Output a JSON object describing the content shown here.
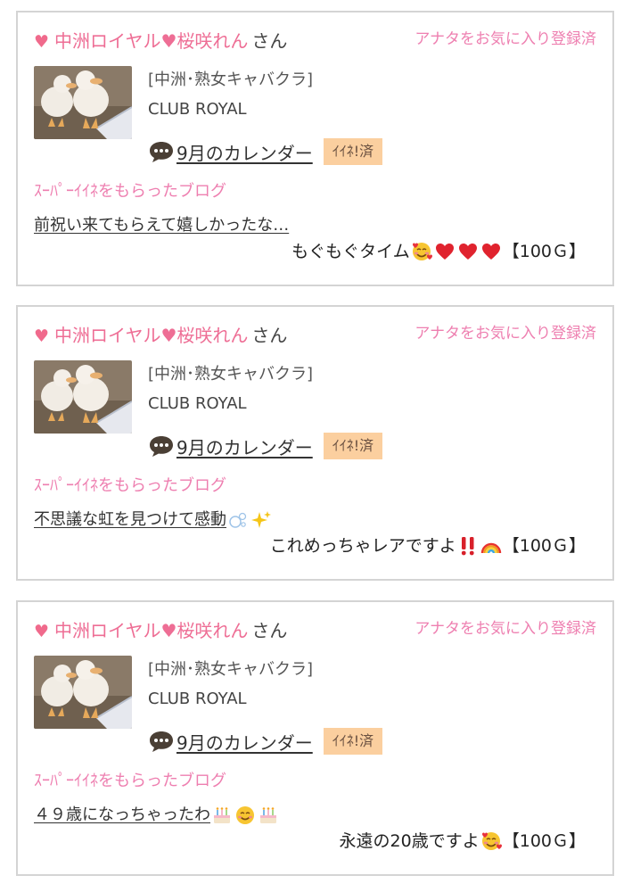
{
  "posts": [
    {
      "shop_name": "中洲ロイヤル♥桜咲れん",
      "honorific": "さん",
      "favorite_status": "アナタをお気に入り登録済",
      "genre": "[中洲･熟女キャバクラ]",
      "store": "CLUB ROYAL",
      "calendar_link": "9月のカレンダー",
      "iine_badge": "ｲｲﾈ!済",
      "super_label": "ｽｰﾊﾟｰｲｲﾈをもらったブログ",
      "blog_title": "前祝い来てもらえて嬉しかったな…",
      "comment_text": "もぐもぐタイム",
      "comment_emojis": [
        "smiling-face-with-hearts-icon",
        "red-heart-icon",
        "red-heart-icon",
        "red-heart-icon"
      ],
      "reward": "【100Ｇ】"
    },
    {
      "shop_name": "中洲ロイヤル♥桜咲れん",
      "honorific": "さん",
      "favorite_status": "アナタをお気に入り登録済",
      "genre": "[中洲･熟女キャバクラ]",
      "store": "CLUB ROYAL",
      "calendar_link": "9月のカレンダー",
      "iine_badge": "ｲｲﾈ!済",
      "super_label": "ｽｰﾊﾟｰｲｲﾈをもらったブログ",
      "blog_title": "不思議な虹を見つけて感動",
      "blog_title_emojis": [
        "bubbles-icon",
        "sparkles-icon"
      ],
      "comment_text": "これめっちゃレアですよ",
      "comment_emojis": [
        "double-exclamation-icon",
        "rainbow-icon"
      ],
      "reward": "【100Ｇ】"
    },
    {
      "shop_name": "中洲ロイヤル♥桜咲れん",
      "honorific": "さん",
      "favorite_status": "アナタをお気に入り登録済",
      "genre": "[中洲･熟女キャバクラ]",
      "store": "CLUB ROYAL",
      "calendar_link": "9月のカレンダー",
      "iine_badge": "ｲｲﾈ!済",
      "super_label": "ｽｰﾊﾟｰｲｲﾈをもらったブログ",
      "blog_title": "４９歳になっちゃったわ",
      "blog_title_emojis": [
        "birthday-cake-icon",
        "smiling-face-icon",
        "birthday-cake-icon"
      ],
      "comment_text": "永遠の20歳ですよ",
      "comment_emojis": [
        "smiling-face-with-hearts-icon"
      ],
      "reward": "【100Ｇ】"
    }
  ]
}
